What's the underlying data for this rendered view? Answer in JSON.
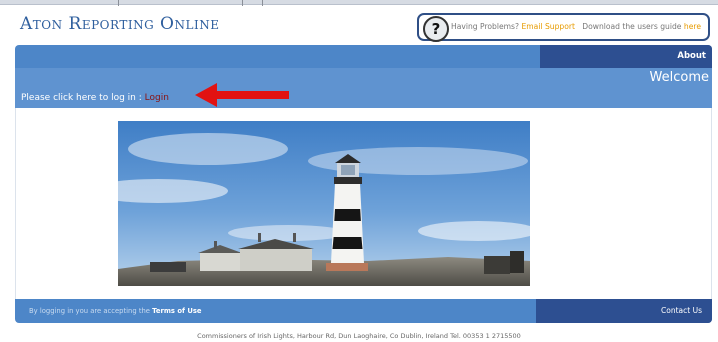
{
  "brand": {
    "title": "Aton Reporting Online"
  },
  "help": {
    "prefix": "Having Problems?",
    "email_link": "Email Support",
    "guide_text": "Download the users guide",
    "guide_link": "here"
  },
  "nav": {
    "about": "About"
  },
  "welcome": {
    "heading": "Welcome",
    "login_prompt": "Please click here to log in : ",
    "login_link": "Login"
  },
  "footer": {
    "terms_prefix": "By logging in you are accepting the ",
    "terms_link": "Terms of Use",
    "contact": "Contact Us",
    "address": "Commissioners of Irish Lights, Harbour Rd, Dun Laoghaire, Co Dublin, Ireland Tel. 00353 1 2715500"
  },
  "colors": {
    "brand": "#2f5f9e",
    "bar": "#4d86c8",
    "bar_dark": "#2d4f91",
    "login": "#8a1212",
    "arrow": "#e21212",
    "link": "#e79b00"
  }
}
